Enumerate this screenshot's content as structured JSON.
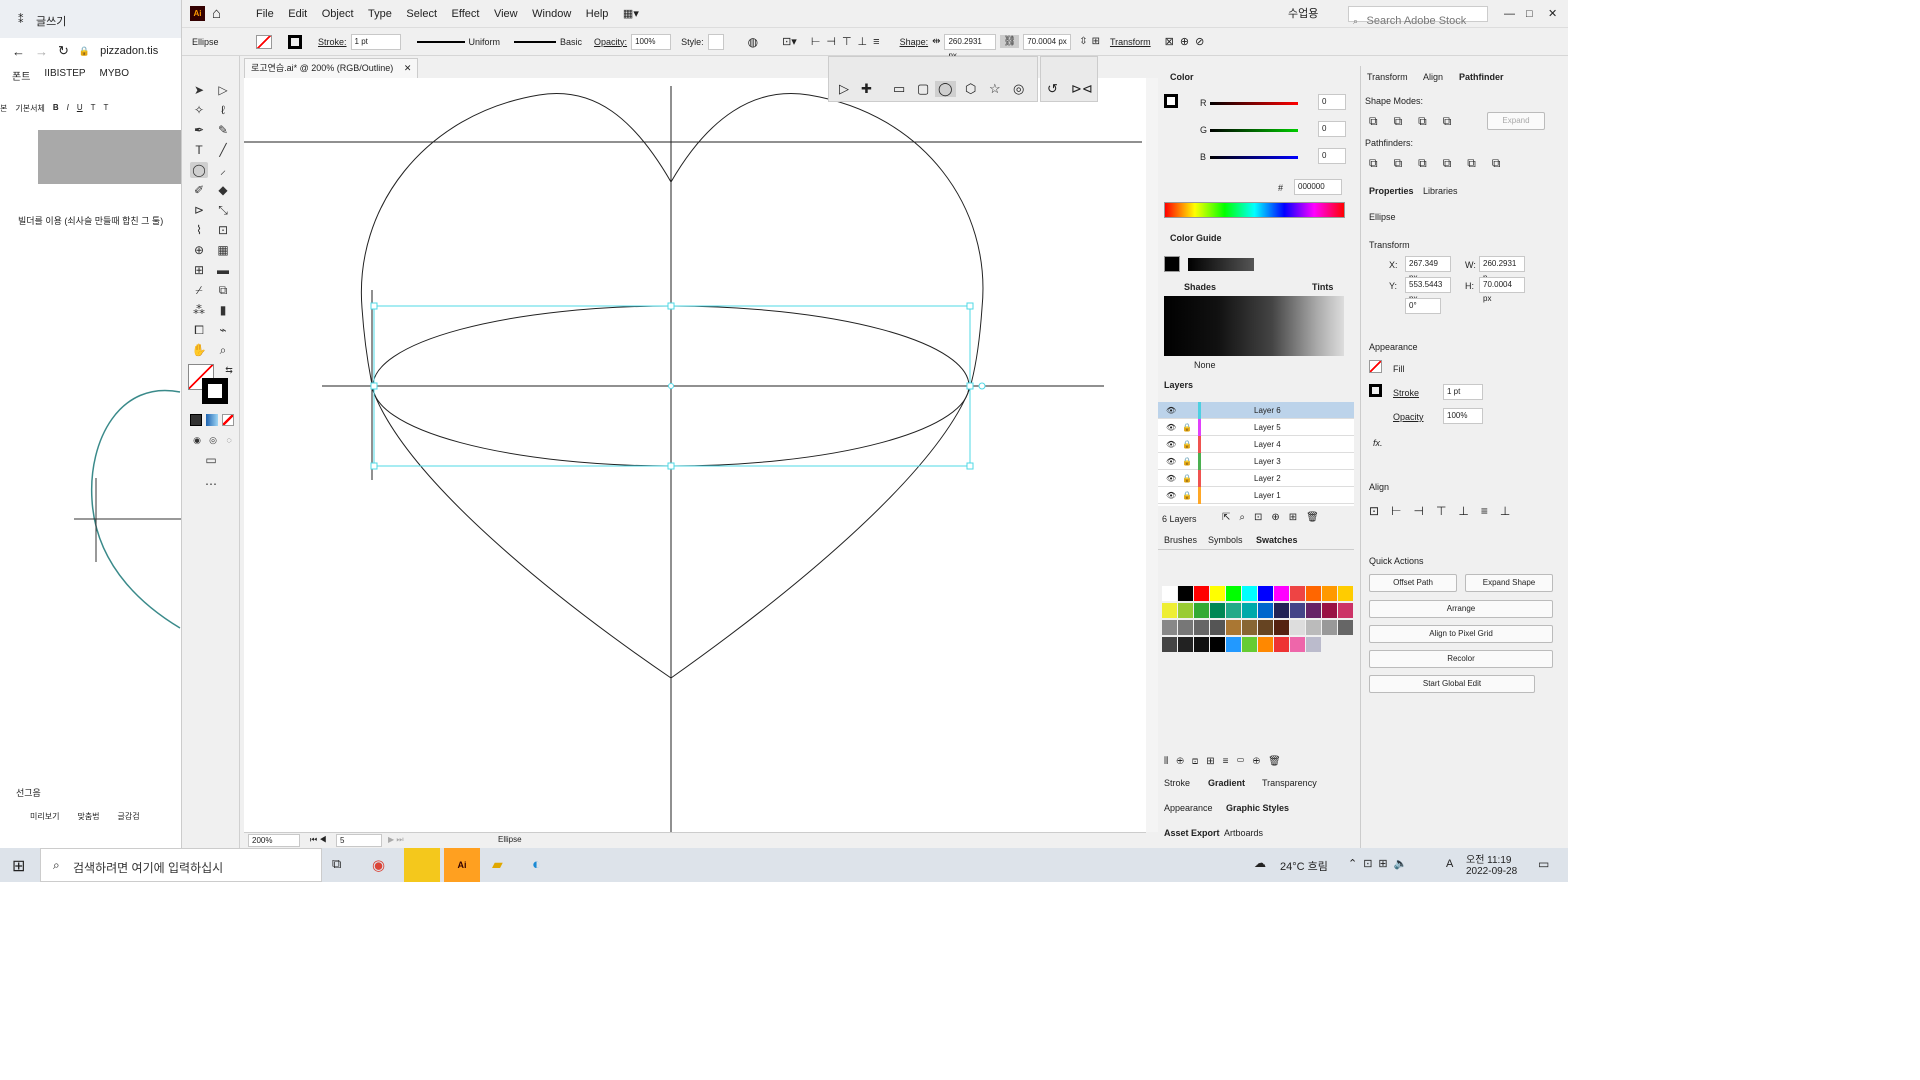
{
  "browser": {
    "tab_title": "글쓰기",
    "address": "pizzadon.tis",
    "bookmarks": [
      "폰트",
      "IIBISTEP",
      "MYBO"
    ],
    "toolbar": [
      "본",
      "기본서체",
      "B",
      "I",
      "U",
      "T",
      "T"
    ],
    "caption": "빌더를 이용 (쇠사슬 만들때 합친 그 툴)",
    "footer_label": "선그음",
    "footer_buttons": [
      "미리보기",
      "맞춤법",
      "글감검"
    ]
  },
  "menu": {
    "items": [
      "File",
      "Edit",
      "Object",
      "Type",
      "Select",
      "Effect",
      "View",
      "Window",
      "Help"
    ],
    "workspace": "수업용",
    "search_placeholder": "Search Adobe Stock"
  },
  "control": {
    "object": "Ellipse",
    "stroke_label": "Stroke:",
    "stroke_value": "1 pt",
    "uniform": "Uniform",
    "basic": "Basic",
    "opacity_label": "Opacity:",
    "opacity_value": "100%",
    "style_label": "Style:",
    "shape_label": "Shape:",
    "width": "260.2931 px",
    "height": "70.0004 px",
    "transform": "Transform"
  },
  "document": {
    "tab": "로고연습.ai* @ 200% (RGB/Outline)",
    "zoom": "200%",
    "artboard": "5",
    "status_tool": "Ellipse"
  },
  "color_panel": {
    "title": "Color",
    "r": "0",
    "g": "0",
    "b": "0",
    "hex": "000000",
    "labels": [
      "R",
      "G",
      "B"
    ]
  },
  "color_guide": {
    "title": "Color Guide",
    "shades": "Shades",
    "tints": "Tints",
    "none": "None"
  },
  "layers": {
    "title": "Layers",
    "count": "6 Layers",
    "items": [
      "Layer 6",
      "Layer 5",
      "Layer 4",
      "Layer 3",
      "Layer 2",
      "Layer 1"
    ],
    "colors": [
      "#4dd0e1",
      "#e040fb",
      "#ef5350",
      "#4caf50",
      "#ef5350",
      "#ffa726"
    ]
  },
  "swatch_tabs": [
    "Brushes",
    "Symbols",
    "Swatches"
  ],
  "bottom_tabs": {
    "row1": [
      "Stroke",
      "Gradient",
      "Transparency"
    ],
    "row2": [
      "Appearance",
      "Graphic Styles"
    ],
    "row3": [
      "Asset Export",
      "Artboards"
    ]
  },
  "right_tabs": [
    "Transform",
    "Align",
    "Pathfinder"
  ],
  "pathfinder": {
    "shape_modes": "Shape Modes:",
    "pathfinders": "Pathfinders:",
    "expand": "Expand"
  },
  "properties": {
    "tabs": [
      "Properties",
      "Libraries"
    ],
    "object": "Ellipse",
    "transform": "Transform",
    "x_label": "X:",
    "x": "267.349 px",
    "y_label": "Y:",
    "y": "553.5443 px",
    "w_label": "W:",
    "w": "260.2931 p",
    "h_label": "H:",
    "h": "70.0004 px",
    "angle": "0°",
    "appearance": "Appearance",
    "fill": "Fill",
    "stroke": "Stroke",
    "stroke_val": "1 pt",
    "opacity": "Opacity",
    "opacity_val": "100%",
    "fx": "fx.",
    "align": "Align",
    "quick_actions": "Quick Actions",
    "buttons": [
      "Offset Path",
      "Expand Shape",
      "Arrange",
      "Align to Pixel Grid",
      "Recolor",
      "Start Global Edit"
    ]
  },
  "taskbar": {
    "search": "검색하려면 여기에 입력하십시",
    "weather": "24°C 흐림",
    "time": "오전 11:19",
    "date": "2022-09-28",
    "ime": "A"
  }
}
